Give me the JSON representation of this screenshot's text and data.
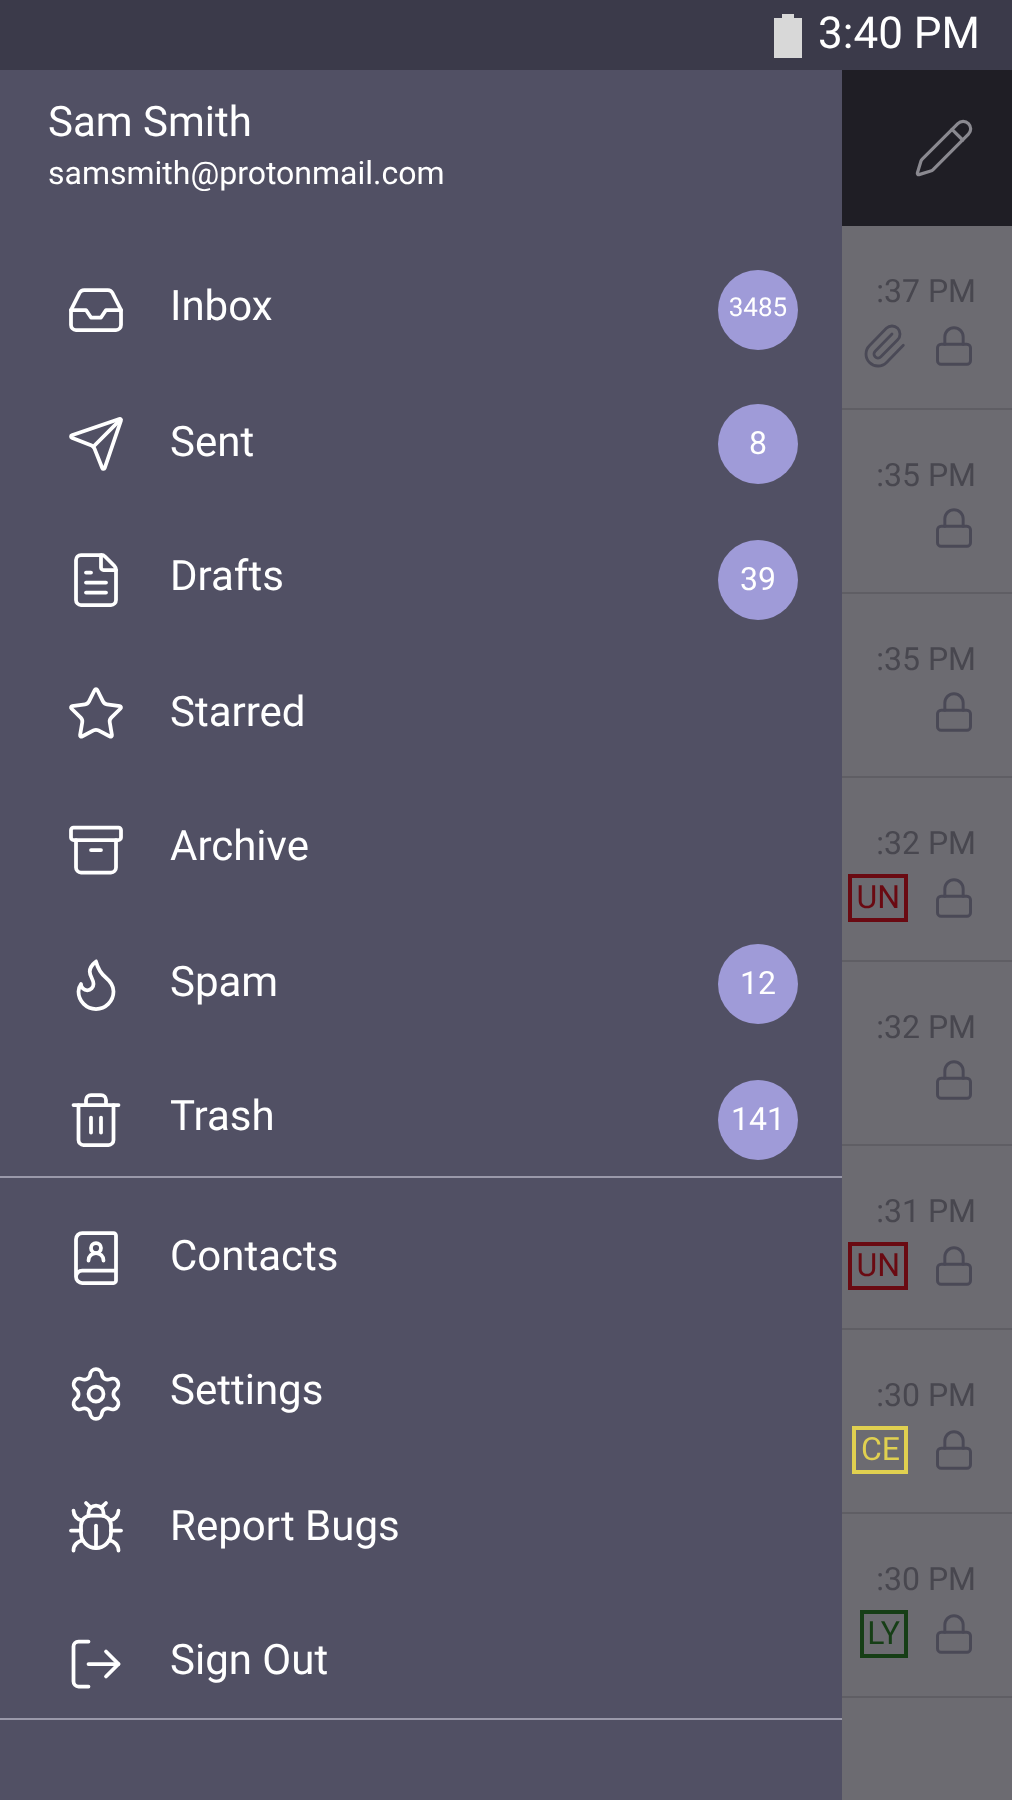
{
  "status_bar": {
    "time": "3:40 PM"
  },
  "account": {
    "name": "Sam Smith",
    "email": "samsmith@protonmail.com"
  },
  "menu": [
    {
      "kind": "inbox",
      "label": "Inbox",
      "count": "3485"
    },
    {
      "kind": "sent",
      "label": "Sent",
      "count": "8"
    },
    {
      "kind": "drafts",
      "label": "Drafts",
      "count": "39"
    },
    {
      "kind": "starred",
      "label": "Starred"
    },
    {
      "kind": "archive",
      "label": "Archive"
    },
    {
      "kind": "spam",
      "label": "Spam",
      "count": "12"
    },
    {
      "kind": "trash",
      "label": "Trash",
      "count": "141"
    }
  ],
  "menu_secondary": [
    {
      "kind": "contacts",
      "label": "Contacts"
    },
    {
      "kind": "settings",
      "label": "Settings"
    },
    {
      "kind": "bugs",
      "label": "Report Bugs"
    },
    {
      "kind": "signout",
      "label": "Sign Out"
    }
  ],
  "messages": [
    {
      "time": ":37 PM",
      "attachment": true
    },
    {
      "time": ":35 PM",
      "attachment": false
    },
    {
      "time": ":35 PM",
      "attachment": false
    },
    {
      "time": ":32 PM",
      "attachment": false,
      "tag": "UN",
      "color": "#6a0a12"
    },
    {
      "time": ":32 PM",
      "attachment": false
    },
    {
      "time": ":31 PM",
      "attachment": false,
      "tag": "UN",
      "color": "#6a0a12"
    },
    {
      "time": ":30 PM",
      "attachment": false,
      "tag": "CE",
      "color": "#e0d050"
    },
    {
      "time": ":30 PM",
      "attachment": false,
      "tag": "LY",
      "color": "#163e16"
    }
  ]
}
